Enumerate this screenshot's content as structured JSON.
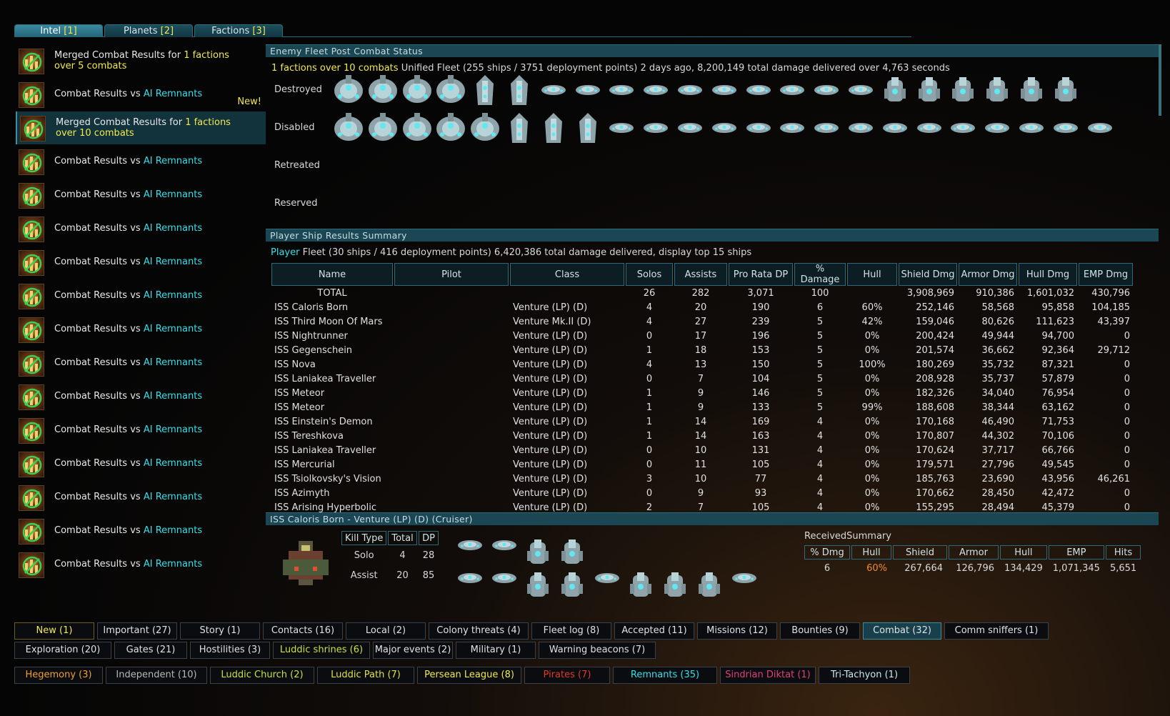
{
  "tabs": [
    {
      "label": "Intel",
      "num": "[1]"
    },
    {
      "label": "Planets",
      "num": "[2]"
    },
    {
      "label": "Factions",
      "num": "[3]"
    }
  ],
  "left_list": [
    {
      "pre": "Merged Combat Results for ",
      "hl": "1 factions",
      "post": "",
      "line2": "over 5 combats",
      "line2_hl": true,
      "kind": "merged"
    },
    {
      "pre": "Combat Results vs ",
      "hl": "AI Remnants",
      "kind": "single",
      "new": "New!"
    },
    {
      "pre": "Merged Combat Results for ",
      "hl": "1 factions",
      "post": "",
      "line2": "over 10 combats",
      "line2_hl": true,
      "kind": "merged",
      "selected": true
    },
    {
      "pre": "Combat Results vs ",
      "hl": "AI Remnants",
      "kind": "single"
    },
    {
      "pre": "Combat Results vs ",
      "hl": "AI Remnants",
      "kind": "single"
    },
    {
      "pre": "Combat Results vs ",
      "hl": "AI Remnants",
      "kind": "single"
    },
    {
      "pre": "Combat Results vs ",
      "hl": "AI Remnants",
      "kind": "single"
    },
    {
      "pre": "Combat Results vs ",
      "hl": "AI Remnants",
      "kind": "single"
    },
    {
      "pre": "Combat Results vs ",
      "hl": "AI Remnants",
      "kind": "single"
    },
    {
      "pre": "Combat Results vs ",
      "hl": "AI Remnants",
      "kind": "single"
    },
    {
      "pre": "Combat Results vs ",
      "hl": "AI Remnants",
      "kind": "single"
    },
    {
      "pre": "Combat Results vs ",
      "hl": "AI Remnants",
      "kind": "single"
    },
    {
      "pre": "Combat Results vs ",
      "hl": "AI Remnants",
      "kind": "single"
    },
    {
      "pre": "Combat Results vs ",
      "hl": "AI Remnants",
      "kind": "single"
    },
    {
      "pre": "Combat Results vs ",
      "hl": "AI Remnants",
      "kind": "single"
    },
    {
      "pre": "Combat Results vs ",
      "hl": "AI Remnants",
      "kind": "single"
    }
  ],
  "enemy": {
    "header": "Enemy Fleet Post Combat Status",
    "info_hl": "1 factions over 10 combats",
    "info_rest": " Unified Fleet (255 ships / 3751 deployment points) 2 days ago, 8,200,149 total damage delivered over 4,763 seconds",
    "rows": [
      {
        "label": "Destroyed",
        "ships": [
          "big",
          "big",
          "big",
          "big",
          "tall",
          "tall",
          "flat",
          "flat",
          "flat",
          "flat",
          "flat",
          "flat",
          "flat",
          "flat",
          "flat",
          "flat",
          "pod",
          "pod",
          "pod",
          "pod",
          "pod",
          "pod"
        ]
      },
      {
        "label": "Disabled",
        "ships": [
          "big",
          "big",
          "big",
          "big",
          "big",
          "tall",
          "tall",
          "tall",
          "flat",
          "flat",
          "flat",
          "flat",
          "flat",
          "flat",
          "flat",
          "flat",
          "flat",
          "flat",
          "flat",
          "flat",
          "flat",
          "flat",
          "flat"
        ]
      },
      {
        "label": "Retreated",
        "ships": []
      },
      {
        "label": "Reserved",
        "ships": []
      }
    ]
  },
  "player": {
    "header": "Player Ship Results Summary",
    "info_hl": "Player",
    "info_rest": " Fleet (30 ships / 416 deployment points) 6,420,386 total damage delivered, display top 15 ships",
    "columns": [
      "Name",
      "Pilot",
      "Class",
      "Solos",
      "Assists",
      "Pro Rata DP",
      "% Damage",
      "Hull",
      "Shield Dmg",
      "Armor Dmg",
      "Hull Dmg",
      "EMP Dmg"
    ],
    "total": [
      "TOTAL",
      "",
      "",
      "26",
      "282",
      "3,071",
      "100",
      "",
      "3,908,969",
      "910,386",
      "1,601,032",
      "430,796"
    ],
    "rows": [
      [
        "ISS Caloris Born",
        "",
        "Venture (LP) (D)",
        "4",
        "20",
        "190",
        "6",
        "60%",
        "252,146",
        "58,568",
        "95,858",
        "104,185"
      ],
      [
        "ISS Third Moon Of Mars",
        "",
        "Venture Mk.II (D)",
        "4",
        "27",
        "239",
        "5",
        "42%",
        "159,046",
        "80,626",
        "111,623",
        "43,397"
      ],
      [
        "ISS Nightrunner",
        "",
        "Venture (LP) (D)",
        "0",
        "17",
        "196",
        "5",
        "0%",
        "200,424",
        "49,944",
        "94,700",
        "0"
      ],
      [
        "ISS Gegenschein",
        "",
        "Venture (LP) (D)",
        "1",
        "18",
        "153",
        "5",
        "0%",
        "201,574",
        "36,662",
        "92,364",
        "29,712"
      ],
      [
        "ISS Nova",
        "",
        "Venture (LP) (D)",
        "4",
        "13",
        "150",
        "5",
        "100%",
        "180,269",
        "35,732",
        "87,321",
        "0"
      ],
      [
        "ISS Laniakea Traveller",
        "",
        "Venture (LP) (D)",
        "0",
        "7",
        "104",
        "5",
        "0%",
        "208,928",
        "35,737",
        "57,879",
        "0"
      ],
      [
        "ISS Meteor",
        "",
        "Venture (LP) (D)",
        "1",
        "9",
        "146",
        "5",
        "0%",
        "182,326",
        "34,040",
        "76,954",
        "0"
      ],
      [
        "ISS Meteor",
        "",
        "Venture (LP) (D)",
        "1",
        "9",
        "133",
        "5",
        "99%",
        "188,608",
        "38,344",
        "63,162",
        "0"
      ],
      [
        "ISS Einstein's Demon",
        "",
        "Venture (LP) (D)",
        "1",
        "14",
        "169",
        "4",
        "0%",
        "170,168",
        "46,490",
        "71,753",
        "0"
      ],
      [
        "ISS Tereshkova",
        "",
        "Venture (LP) (D)",
        "1",
        "14",
        "163",
        "4",
        "0%",
        "170,807",
        "44,302",
        "70,106",
        "0"
      ],
      [
        "ISS Laniakea Traveller",
        "",
        "Venture (LP) (D)",
        "0",
        "10",
        "131",
        "4",
        "0%",
        "170,624",
        "37,717",
        "66,766",
        "0"
      ],
      [
        "ISS Mercurial",
        "",
        "Venture (LP) (D)",
        "0",
        "11",
        "105",
        "4",
        "0%",
        "179,571",
        "27,796",
        "49,545",
        "0"
      ],
      [
        "ISS Tsiolkovsky's Vision",
        "",
        "Venture (LP) (D)",
        "3",
        "10",
        "77",
        "4",
        "0%",
        "185,763",
        "23,690",
        "43,956",
        "46,261"
      ],
      [
        "ISS Azimyth",
        "",
        "Venture (LP) (D)",
        "0",
        "9",
        "93",
        "4",
        "0%",
        "170,662",
        "28,450",
        "42,472",
        "0"
      ],
      [
        "ISS Arising Hyperbolic",
        "",
        "Venture (LP) (D)",
        "2",
        "7",
        "105",
        "4",
        "0%",
        "155,295",
        "28,494",
        "45,379",
        "0"
      ]
    ]
  },
  "detail": {
    "header": "ISS Caloris Born - Venture (LP) (D) (Cruiser)",
    "kill_columns": [
      "Kill Type",
      "Total",
      "DP"
    ],
    "kill_rows": [
      [
        "Solo",
        "4",
        "28"
      ],
      [
        "Assist",
        "20",
        "85"
      ]
    ],
    "received_title": "ReceivedSummary",
    "received_columns": [
      "% Dmg",
      "Hull",
      "Shield",
      "Armor",
      "Hull",
      "EMP",
      "Hits"
    ],
    "received_row": [
      "6",
      "60%",
      "267,664",
      "126,796",
      "134,429",
      "1,071,345",
      "5,651"
    ]
  },
  "filters_row1": [
    "New (1)",
    "Important (27)",
    "Story (1)",
    "Contacts (16)",
    "Local (2)",
    "Colony threats (4)",
    "Fleet log (8)",
    "Accepted (11)",
    "Missions (12)",
    "Bounties (9)",
    "Combat (32)",
    "Comm sniffers (1)"
  ],
  "filters_row2": [
    "Exploration (20)",
    "Gates (21)",
    "Hostilities (3)",
    "Luddic shrines (6)",
    "Major events (2)",
    "Military (1)",
    "Warning beacons (7)"
  ],
  "factions": [
    {
      "label": "Hegemony (3)",
      "color": "#f0a030"
    },
    {
      "label": "Independent (10)",
      "color": "#b8b8b8"
    },
    {
      "label": "Luddic Church (2)",
      "color": "#c8e040"
    },
    {
      "label": "Luddic Path (7)",
      "color": "#e0e040"
    },
    {
      "label": "Persean League (8)",
      "color": "#f2e94c"
    },
    {
      "label": "Pirates (7)",
      "color": "#e03a2a"
    },
    {
      "label": "Remnants (35)",
      "color": "#34e0ea"
    },
    {
      "label": "Sindrian Diktat (1)",
      "color": "#e0407a"
    },
    {
      "label": "Tri-Tachyon (1)",
      "color": "#c8e8f0"
    }
  ],
  "colors": {
    "accent": "#34e0ea",
    "highlight": "#f2e94c",
    "panel_header": "#1b4654",
    "border": "#2f6a78"
  }
}
